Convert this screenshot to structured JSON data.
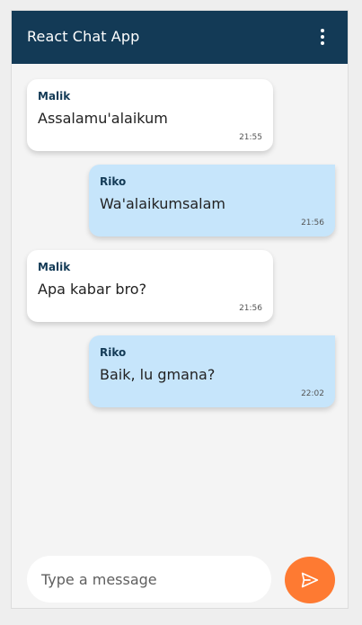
{
  "header": {
    "title": "React Chat App",
    "menu_icon": "more-vertical-icon",
    "background": "#133a56"
  },
  "messages": [
    {
      "sender": "Malik",
      "text": "Assalamu'alaikum",
      "time": "21:55",
      "side": "left"
    },
    {
      "sender": "Riko",
      "text": "Wa'alaikumsalam",
      "time": "21:56",
      "side": "right"
    },
    {
      "sender": "Malik",
      "text": "Apa kabar bro?",
      "time": "21:56",
      "side": "left"
    },
    {
      "sender": "Riko",
      "text": "Baik, lu gmana?",
      "time": "22:02",
      "side": "right"
    }
  ],
  "composer": {
    "placeholder": "Type a message",
    "value": "",
    "send_icon": "send-icon",
    "send_color": "#fe7a32"
  },
  "colors": {
    "incoming_bubble": "#ffffff",
    "outgoing_bubble": "#c6e5fb",
    "background": "#f4f4f4"
  }
}
